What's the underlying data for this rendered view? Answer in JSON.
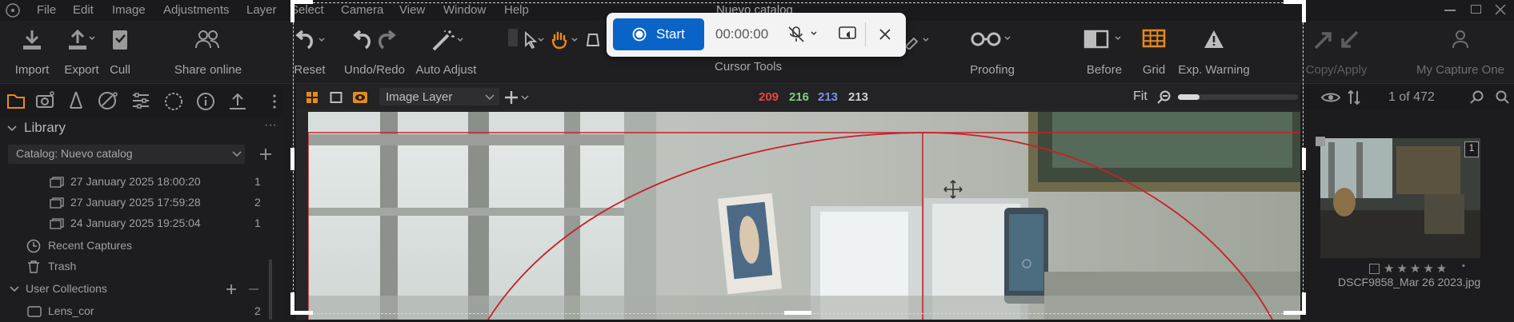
{
  "menubar": {
    "items": [
      "File",
      "Edit",
      "Image",
      "Adjustments",
      "Layer",
      "Select",
      "Camera",
      "View",
      "Window",
      "Help"
    ],
    "title": "Nuevo catalog"
  },
  "toolbar": {
    "import": "Import",
    "export": "Export",
    "cull": "Cull",
    "share": "Share online",
    "reset": "Reset",
    "undo_redo": "Undo/Redo",
    "auto_adjust": "Auto Adjust",
    "cursor_tools": "Cursor Tools",
    "proofing": "Proofing",
    "before": "Before",
    "grid": "Grid",
    "exp_warning": "Exp. Warning",
    "copy_apply": "Copy/Apply",
    "my_capture_one": "My Capture One"
  },
  "viewer_bar": {
    "layer": "Image Layer",
    "r": "209",
    "g": "216",
    "b": "213",
    "l": "213",
    "fit": "Fit",
    "zoom_level": 0.18
  },
  "library": {
    "title": "Library",
    "catalog": "Catalog: Nuevo catalog",
    "items": [
      {
        "label": "27 January 2025 18:00:20",
        "count": "1"
      },
      {
        "label": "27 January 2025 17:59:28",
        "count": "2"
      },
      {
        "label": "24 January 2025 19:25:04",
        "count": "1"
      }
    ],
    "recent": "Recent Captures",
    "trash": "Trash",
    "user_collections": "User Collections",
    "lens_cor": {
      "label": "Lens_cor",
      "count": "2"
    }
  },
  "browser": {
    "counter": "1 of 472",
    "thumb_badge": "1",
    "filename": "DSCF9858_Mar 26 2023.jpg",
    "rating": 0
  },
  "recorder": {
    "start": "Start",
    "time": "00:00:00"
  },
  "colors": {
    "accent_orange": "#e88a1a",
    "red_value": "#e8473f",
    "green_value": "#7fd07f",
    "blue_value": "#7a8ef0",
    "recorder_blue": "#0a64c8",
    "guide_red": "#c8202a"
  }
}
